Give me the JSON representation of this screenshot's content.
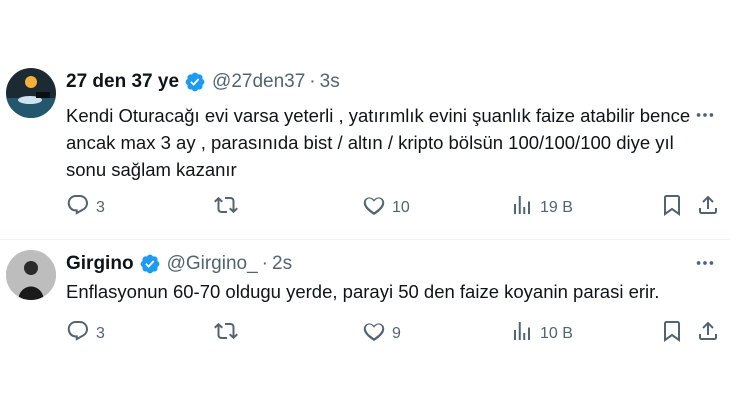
{
  "tweets": [
    {
      "name": "27 den 37 ye",
      "handle": "@27den37",
      "separator": "·",
      "time": "3s",
      "text": "Kendi Oturacağı evi varsa yeterli , yatırımlık evini şuanlık faize atabilir bence\nancak max 3 ay , parasınıda bist / altın / kripto bölsün 100/100/100 diye yıl\nsonu sağlam kazanır",
      "replies": "3",
      "retweets": "",
      "likes": "10",
      "views": "19 B"
    },
    {
      "name": "Girgino",
      "handle": "@Girgino_",
      "separator": "·",
      "time": "2s",
      "text": "Enflasyonun 60-70 oldugu yerde, parayi 50 den faize koyanin parasi erir.",
      "replies": "3",
      "retweets": "",
      "likes": "9",
      "views": "10 B"
    }
  ],
  "colors": {
    "verified": "#1d9bf0",
    "muted": "#536471",
    "text": "#0f1419",
    "divider": "#eff3f4"
  },
  "icons": [
    "verified-badge-icon",
    "more-options-icon",
    "reply-icon",
    "retweet-icon",
    "like-icon",
    "views-icon",
    "bookmark-icon",
    "share-icon"
  ]
}
